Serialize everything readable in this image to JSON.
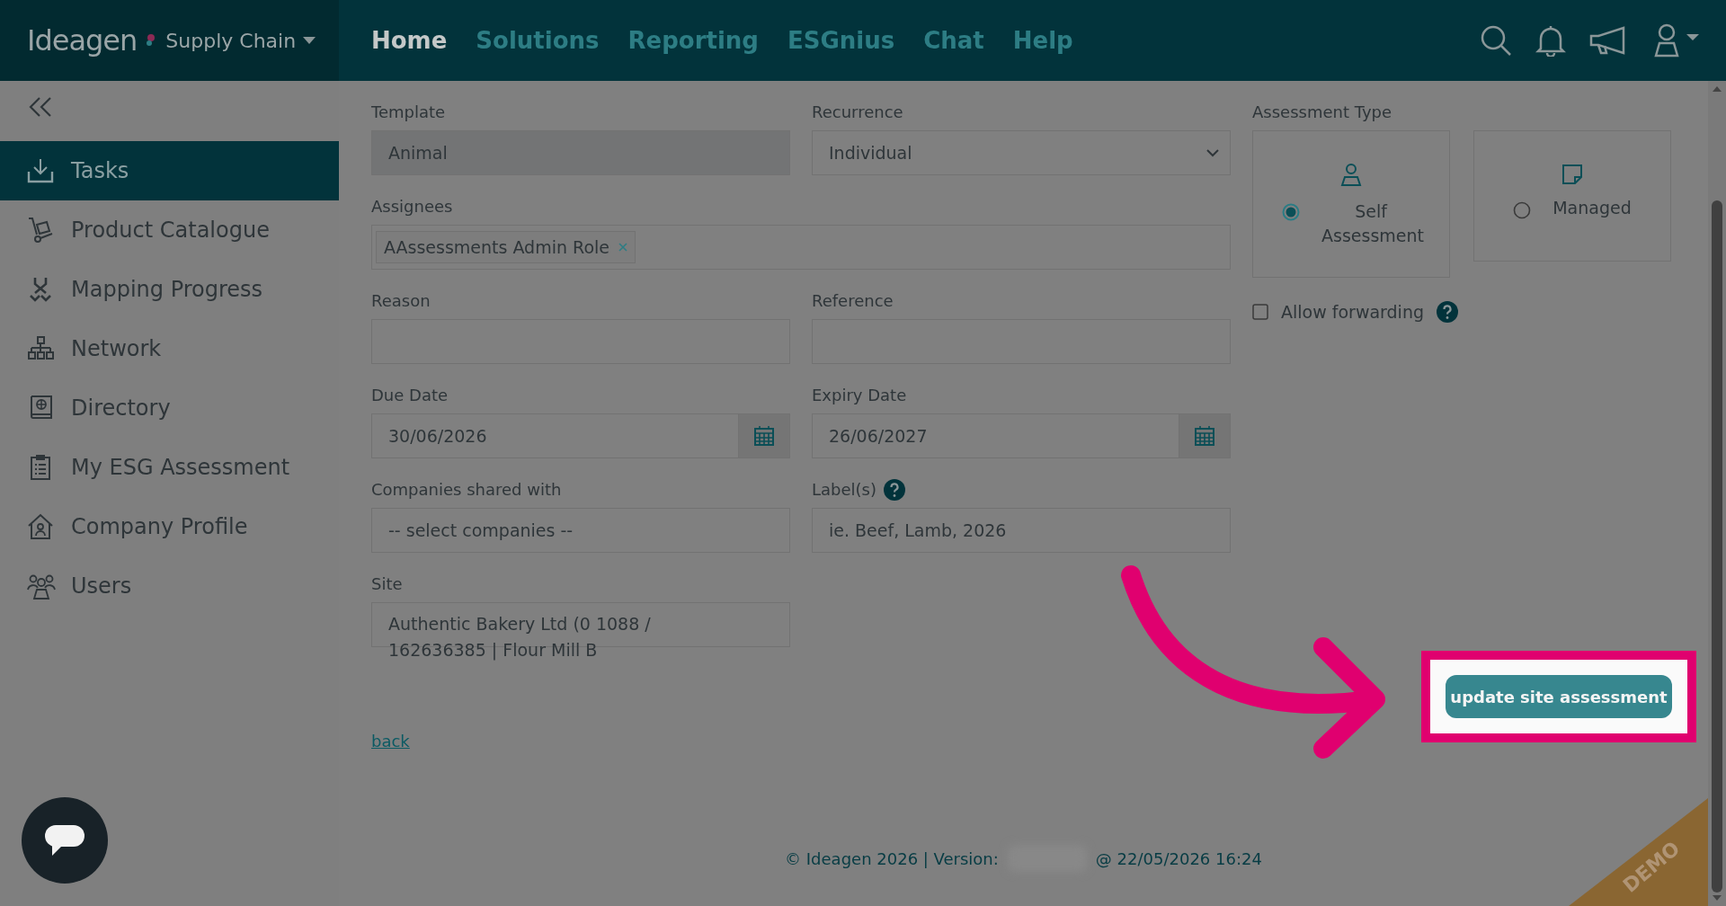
{
  "header": {
    "logo": "Ideagen",
    "product": "Supply Chain",
    "nav": [
      {
        "label": "Home",
        "selected": true
      },
      {
        "label": "Solutions",
        "selected": false
      },
      {
        "label": "Reporting",
        "selected": false
      },
      {
        "label": "ESGnius",
        "selected": false
      },
      {
        "label": "Chat",
        "selected": false
      },
      {
        "label": "Help",
        "selected": false
      }
    ]
  },
  "sidebar": {
    "items": [
      {
        "label": "Tasks",
        "selected": true
      },
      {
        "label": "Product Catalogue",
        "selected": false
      },
      {
        "label": "Mapping Progress",
        "selected": false
      },
      {
        "label": "Network",
        "selected": false
      },
      {
        "label": "Directory",
        "selected": false
      },
      {
        "label": "My ESG Assessment",
        "selected": false
      },
      {
        "label": "Company Profile",
        "selected": false
      },
      {
        "label": "Users",
        "selected": false
      }
    ]
  },
  "form": {
    "fields": [
      {
        "kind": "readonly",
        "label": "Template",
        "value": "Animal"
      },
      {
        "kind": "select",
        "label": "Recurrence",
        "value": "Individual"
      },
      {
        "kind": "tags",
        "label": "Assignees",
        "tags": [
          "AAssessments Admin Role"
        ]
      },
      {
        "kind": "input",
        "label": "Reason"
      },
      {
        "kind": "input",
        "label": "Reference"
      },
      {
        "kind": "date",
        "label": "Due Date",
        "value": "30/06/2026"
      },
      {
        "kind": "date",
        "label": "Expiry Date",
        "value": "26/06/2027"
      },
      {
        "kind": "input",
        "label": "Companies shared with",
        "placeholder": "-- select companies --"
      },
      {
        "kind": "input",
        "label": "Label(s)",
        "help": true,
        "placeholder": "ie. Beef, Lamb, 2026"
      },
      {
        "kind": "site",
        "label": "Site",
        "value": "Authentic Bakery Ltd (0 1088 / 162636385 | Flour Mill B"
      }
    ],
    "back_link": "back"
  },
  "assessment_type": {
    "label": "Assessment Type",
    "options": [
      {
        "label": "Self Assessment",
        "selected": true
      },
      {
        "label": "Managed",
        "selected": false
      }
    ]
  },
  "allow_forwarding": {
    "label": "Allow forwarding",
    "checked": false
  },
  "action_button": "update site assessment",
  "footer": {
    "copyright": "© Ideagen 2026 | Version:",
    "timestamp": "@ 22/05/2026 16:24"
  },
  "demo_ribbon": "DEMO"
}
